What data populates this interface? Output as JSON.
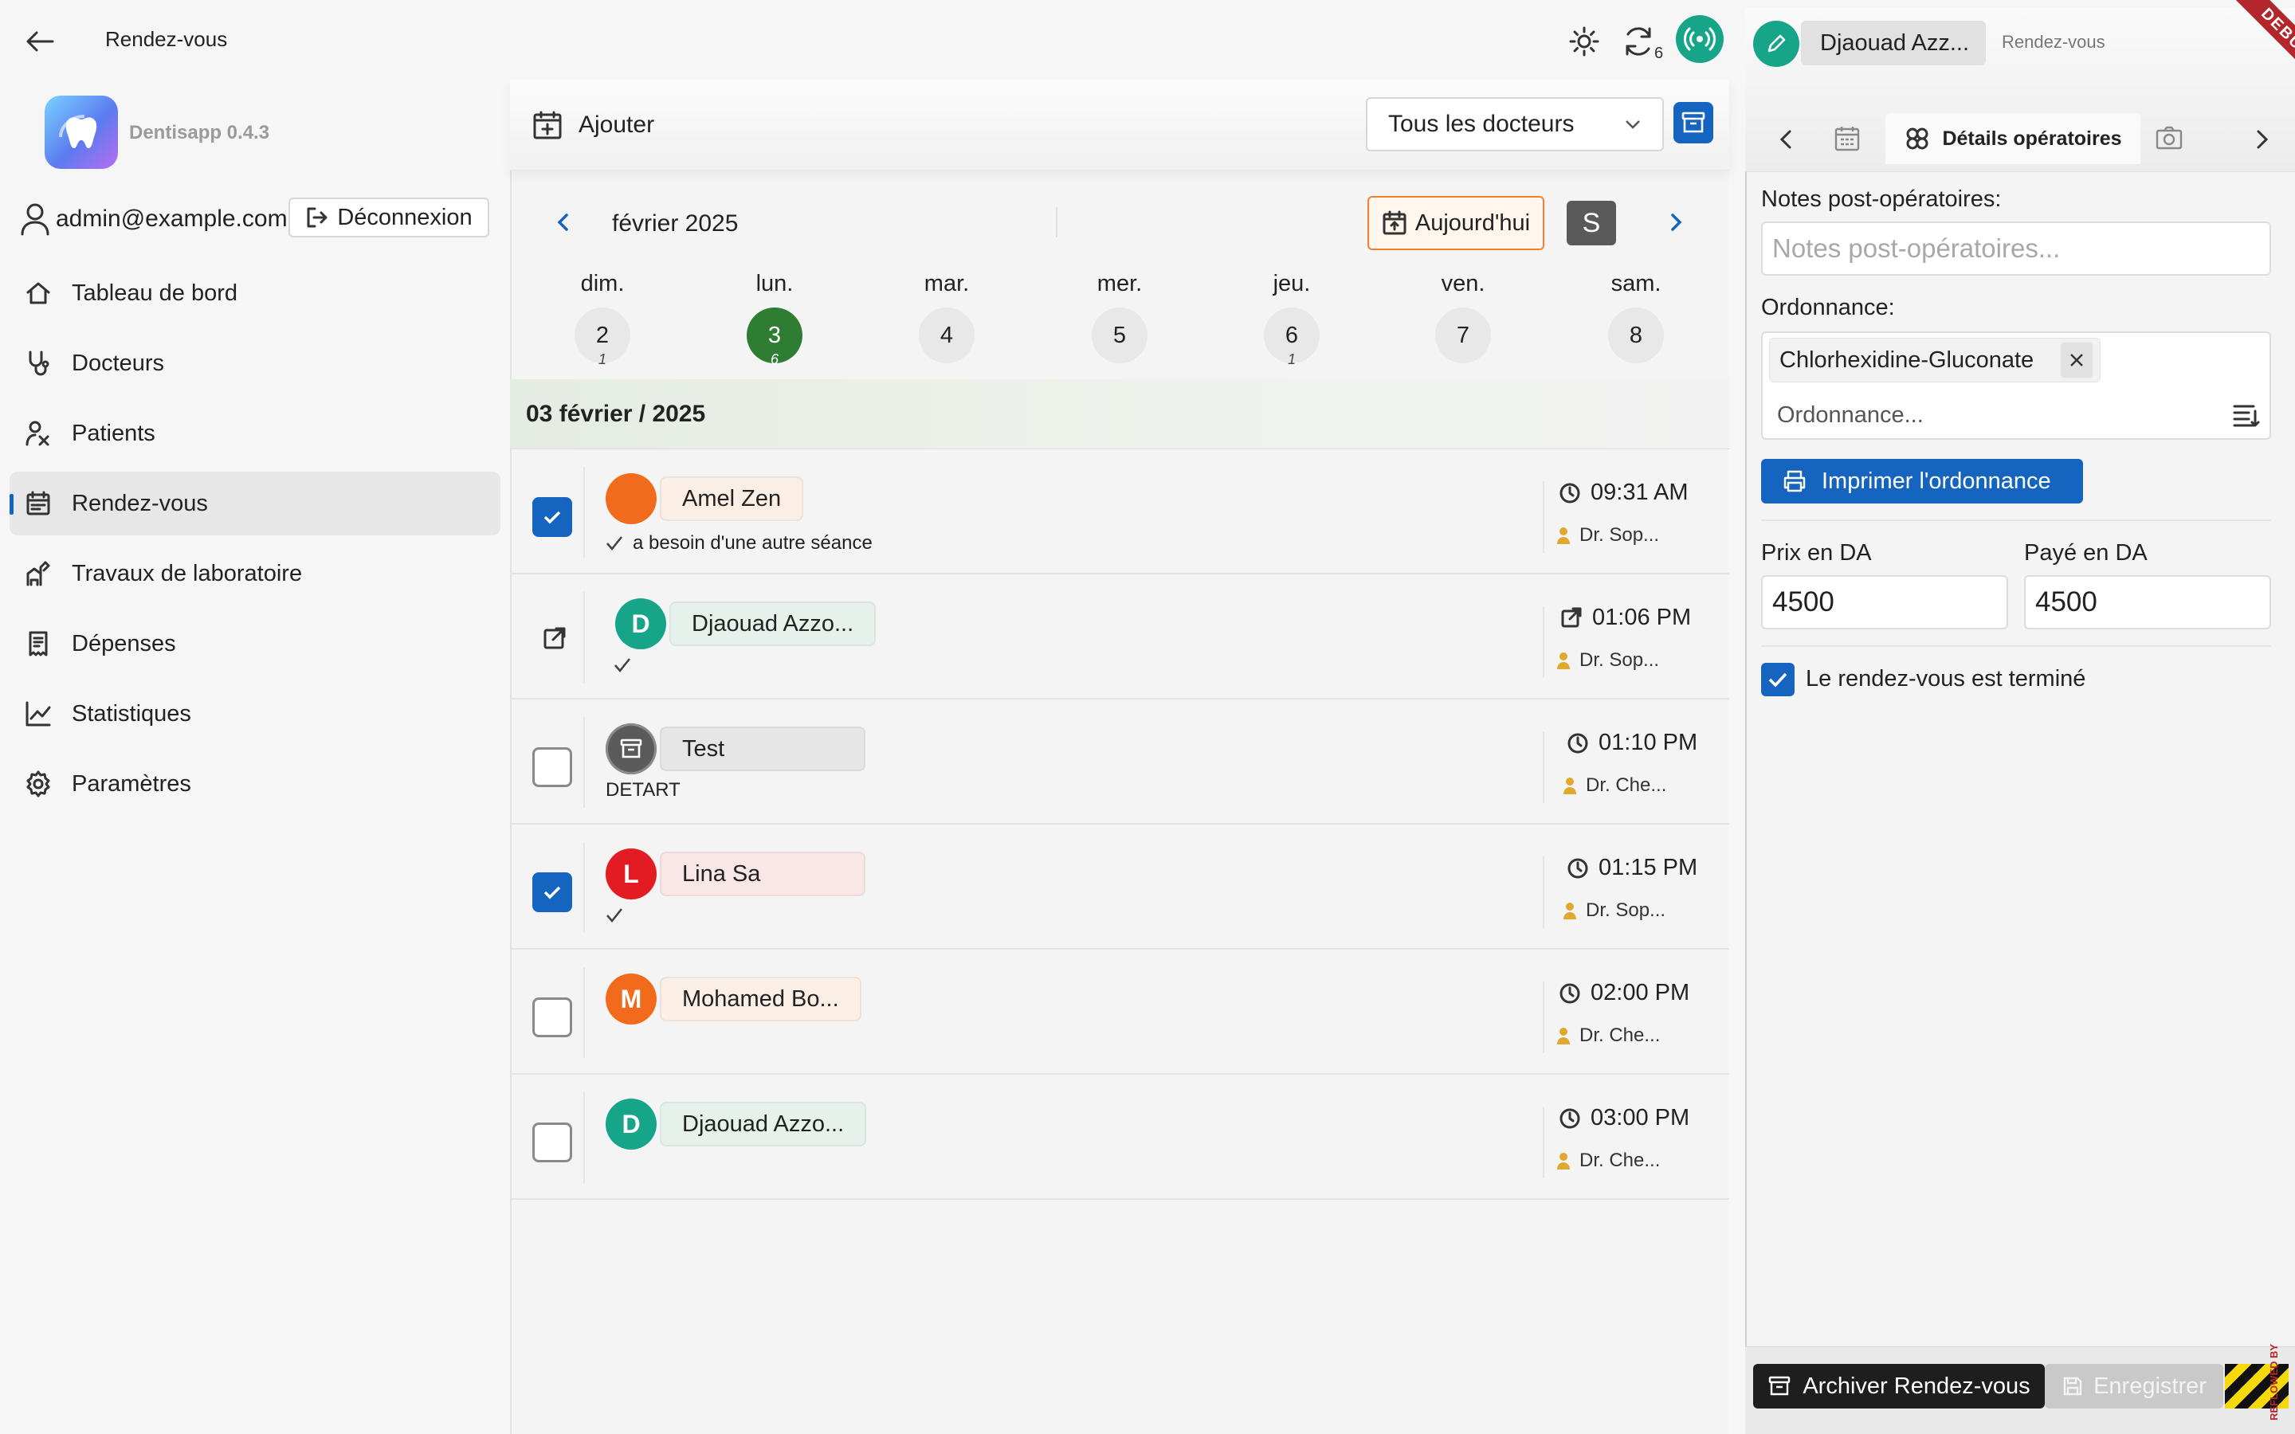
{
  "header": {
    "title": "Rendez-vous",
    "sync_count": "6"
  },
  "sidebar": {
    "app_name": "Dentisapp 0.4.3",
    "user_email": "admin@example.com",
    "logout_label": "Déconnexion",
    "items": [
      {
        "label": "Tableau de bord",
        "icon": "home-icon"
      },
      {
        "label": "Docteurs",
        "icon": "stethoscope-icon"
      },
      {
        "label": "Patients",
        "icon": "patients-icon"
      },
      {
        "label": "Rendez-vous",
        "icon": "calendar-icon",
        "active": true
      },
      {
        "label": "Travaux de laboratoire",
        "icon": "lab-icon"
      },
      {
        "label": "Dépenses",
        "icon": "receipt-icon"
      },
      {
        "label": "Statistiques",
        "icon": "chart-icon"
      },
      {
        "label": "Paramètres",
        "icon": "gear-icon"
      }
    ]
  },
  "toolbar": {
    "add_label": "Ajouter",
    "doctor_filter": "Tous les docteurs"
  },
  "calendar": {
    "month": "février 2025",
    "today_label": "Aujourd'hui",
    "s_label": "S",
    "days": [
      {
        "name": "dim.",
        "num": "2",
        "count": "1",
        "active": false
      },
      {
        "name": "lun.",
        "num": "3",
        "count": "6",
        "active": true
      },
      {
        "name": "mar.",
        "num": "4",
        "count": "",
        "active": false
      },
      {
        "name": "mer.",
        "num": "5",
        "count": "",
        "active": false
      },
      {
        "name": "jeu.",
        "num": "6",
        "count": "1",
        "active": false
      },
      {
        "name": "ven.",
        "num": "7",
        "count": "",
        "active": false
      },
      {
        "name": "sam.",
        "num": "8",
        "count": "",
        "active": false
      }
    ],
    "date_header": "03 février / 2025"
  },
  "appointments": [
    {
      "name": "Amel Zen",
      "avatar": "",
      "avatar_color": "#f26b1d",
      "chip_color": "#fbeee4",
      "checked": true,
      "note": "a besoin d'une autre séance",
      "time": "09:31 AM",
      "doctor": "Dr. Sop..."
    },
    {
      "name": "Djaouad Azzo...",
      "avatar": "D",
      "avatar_color": "#17a589",
      "chip_color": "#e6f1ec",
      "checked": null,
      "note": "",
      "time": "01:06 PM",
      "doctor": "Dr. Sop..."
    },
    {
      "name": "Test",
      "avatar": "",
      "avatar_color": "#5a5a5a",
      "chip_color": "#e6e6e6",
      "checked": false,
      "note": "DETART",
      "time": "01:10 PM",
      "doctor": "Dr. Che..."
    },
    {
      "name": "Lina Sa",
      "avatar": "L",
      "avatar_color": "#e31b23",
      "chip_color": "#f9e6e6",
      "checked": true,
      "note": "",
      "time": "01:15 PM",
      "doctor": "Dr. Sop..."
    },
    {
      "name": "Mohamed Bo...",
      "avatar": "M",
      "avatar_color": "#f26b1d",
      "chip_color": "#fbeee4",
      "checked": false,
      "note": "",
      "time": "02:00 PM",
      "doctor": "Dr. Che..."
    },
    {
      "name": "Djaouad Azzo...",
      "avatar": "D",
      "avatar_color": "#17a589",
      "chip_color": "#e6f1ec",
      "checked": false,
      "note": "",
      "time": "03:00 PM",
      "doctor": "Dr. Che..."
    }
  ],
  "detail": {
    "patient": "Djaouad Azz...",
    "context": "Rendez-vous",
    "debug": "DEBUG",
    "tab_label": "Détails opératoires",
    "notes_label": "Notes post-opératoires:",
    "notes_placeholder": "Notes post-opératoires...",
    "rx_label": "Ordonnance:",
    "rx_item": "Chlorhexidine-Gluconate",
    "rx_placeholder": "Ordonnance...",
    "print_label": "Imprimer l'ordonnance",
    "price_label": "Prix en DA",
    "price_value": "4500",
    "paid_label": "Payé en DA",
    "paid_value": "4500",
    "done_label": "Le rendez-vous est terminé",
    "archive_label": "Archiver Rendez-vous",
    "save_label": "Enregistrer",
    "reflowed": "REFLOWED BY"
  },
  "colors": {
    "primary": "#1565c0",
    "teal": "#17a589",
    "active_day": "#2e7d32",
    "today_border": "#f08030"
  }
}
